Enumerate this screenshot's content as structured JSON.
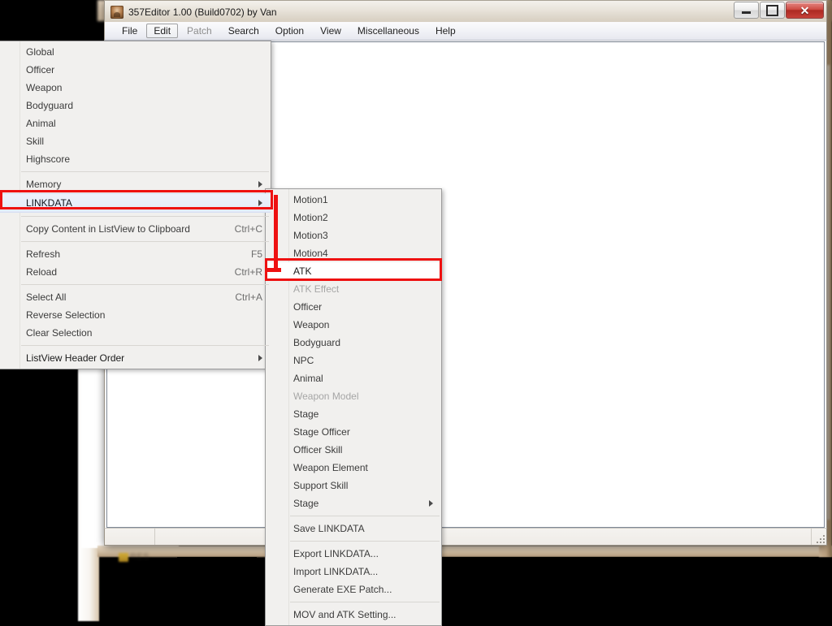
{
  "window": {
    "title": "357Editor 1.00 (Build0702) by Van",
    "icon": "app-portrait-icon",
    "controls": {
      "minimize": "–",
      "maximize": "□",
      "close": "✕"
    }
  },
  "menubar": {
    "items": [
      {
        "label": "File",
        "state": "normal"
      },
      {
        "label": "Edit",
        "state": "open"
      },
      {
        "label": "Patch",
        "state": "disabled"
      },
      {
        "label": "Search",
        "state": "normal"
      },
      {
        "label": "Option",
        "state": "normal"
      },
      {
        "label": "View",
        "state": "normal"
      },
      {
        "label": "Miscellaneous",
        "state": "normal"
      },
      {
        "label": "Help",
        "state": "normal"
      }
    ]
  },
  "edit_menu": {
    "items": [
      {
        "label": "Global",
        "accel": "",
        "type": "item",
        "state": "normal"
      },
      {
        "label": "Officer",
        "accel": "",
        "type": "item",
        "state": "normal"
      },
      {
        "label": "Weapon",
        "accel": "",
        "type": "item",
        "state": "normal"
      },
      {
        "label": "Bodyguard",
        "accel": "",
        "type": "item",
        "state": "normal"
      },
      {
        "label": "Animal",
        "accel": "",
        "type": "item",
        "state": "normal"
      },
      {
        "label": "Skill",
        "accel": "",
        "type": "item",
        "state": "normal"
      },
      {
        "label": "Highscore",
        "accel": "",
        "type": "item",
        "state": "normal"
      },
      {
        "label": "",
        "accel": "",
        "type": "separator",
        "state": "normal"
      },
      {
        "label": "Memory",
        "accel": "",
        "type": "submenu",
        "state": "normal"
      },
      {
        "label": "LINKDATA",
        "accel": "",
        "type": "submenu",
        "state": "selected"
      },
      {
        "label": "",
        "accel": "",
        "type": "separator",
        "state": "normal"
      },
      {
        "label": "Copy Content in ListView to Clipboard",
        "accel": "Ctrl+C",
        "type": "item",
        "state": "normal"
      },
      {
        "label": "",
        "accel": "",
        "type": "separator",
        "state": "normal"
      },
      {
        "label": "Refresh",
        "accel": "F5",
        "type": "item",
        "state": "normal"
      },
      {
        "label": "Reload",
        "accel": "Ctrl+R",
        "type": "item",
        "state": "normal"
      },
      {
        "label": "",
        "accel": "",
        "type": "separator",
        "state": "normal"
      },
      {
        "label": "Select All",
        "accel": "Ctrl+A",
        "type": "item",
        "state": "normal"
      },
      {
        "label": "Reverse Selection",
        "accel": "",
        "type": "item",
        "state": "normal"
      },
      {
        "label": "Clear Selection",
        "accel": "",
        "type": "item",
        "state": "normal"
      },
      {
        "label": "",
        "accel": "",
        "type": "separator",
        "state": "normal"
      },
      {
        "label": "ListView Header Order",
        "accel": "",
        "type": "submenu",
        "state": "strong"
      }
    ]
  },
  "linkdata_submenu": {
    "items": [
      {
        "label": "Motion1",
        "type": "item",
        "state": "normal"
      },
      {
        "label": "Motion2",
        "type": "item",
        "state": "normal"
      },
      {
        "label": "Motion3",
        "type": "item",
        "state": "normal"
      },
      {
        "label": "Motion4",
        "type": "item",
        "state": "normal"
      },
      {
        "label": "ATK",
        "type": "item",
        "state": "annotated"
      },
      {
        "label": "ATK Effect",
        "type": "item",
        "state": "disabled"
      },
      {
        "label": "Officer",
        "type": "item",
        "state": "normal"
      },
      {
        "label": "Weapon",
        "type": "item",
        "state": "normal"
      },
      {
        "label": "Bodyguard",
        "type": "item",
        "state": "normal"
      },
      {
        "label": "NPC",
        "type": "item",
        "state": "normal"
      },
      {
        "label": "Animal",
        "type": "item",
        "state": "normal"
      },
      {
        "label": "Weapon Model",
        "type": "item",
        "state": "disabled"
      },
      {
        "label": "Stage",
        "type": "item",
        "state": "normal"
      },
      {
        "label": "Stage Officer",
        "type": "item",
        "state": "normal"
      },
      {
        "label": "Officer Skill",
        "type": "item",
        "state": "normal"
      },
      {
        "label": "Weapon Element",
        "type": "item",
        "state": "normal"
      },
      {
        "label": "Support Skill",
        "type": "item",
        "state": "normal"
      },
      {
        "label": "Stage",
        "type": "submenu",
        "state": "normal"
      },
      {
        "label": "",
        "type": "separator",
        "state": "normal"
      },
      {
        "label": "Save LINKDATA",
        "type": "item",
        "state": "normal"
      },
      {
        "label": "",
        "type": "separator",
        "state": "normal"
      },
      {
        "label": "Export LINKDATA...",
        "type": "item",
        "state": "normal"
      },
      {
        "label": "Import LINKDATA...",
        "type": "item",
        "state": "normal"
      },
      {
        "label": "Generate EXE Patch...",
        "type": "item",
        "state": "normal"
      },
      {
        "label": "",
        "type": "separator",
        "state": "normal"
      },
      {
        "label": "MOV and ATK Setting...",
        "type": "item",
        "state": "normal"
      }
    ]
  },
  "background": {
    "res_label": "RES"
  },
  "annotations": {
    "accent_color": "#ee1111",
    "boxes": [
      {
        "target": "LINKDATA"
      },
      {
        "target": "ATK"
      }
    ]
  },
  "statusbar": {
    "cells": [
      "",
      ""
    ]
  }
}
